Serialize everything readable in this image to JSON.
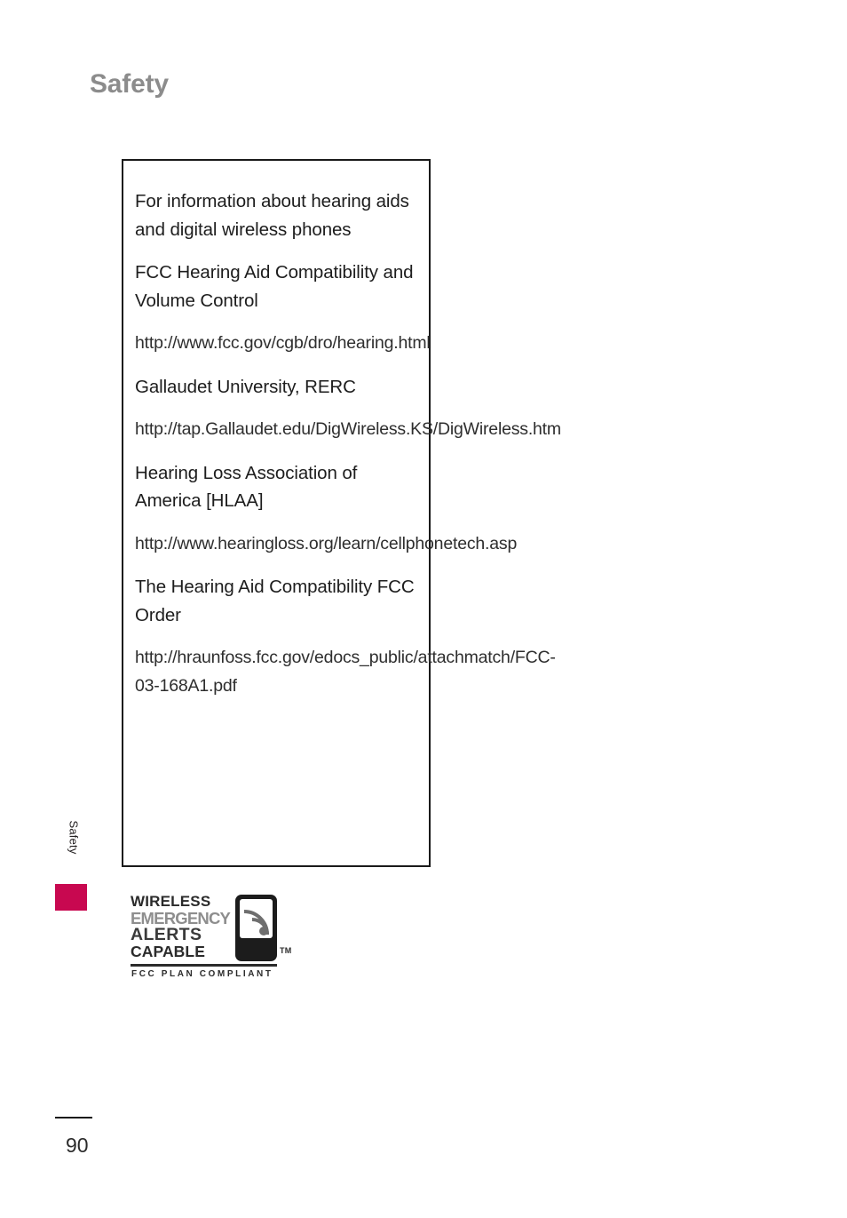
{
  "page": {
    "heading": "Safety",
    "number": "90",
    "side_tab_label": "Safety",
    "accent_color": "#c80850",
    "heading_color": "#8c8c8c",
    "text_color": "#1d1d1d"
  },
  "content_box": {
    "blocks": [
      {
        "kind": "title",
        "text": "For information about hearing aids and digital wireless phones"
      },
      {
        "kind": "title",
        "text": "FCC Hearing Aid Compatibility and Volume Control"
      },
      {
        "kind": "url",
        "text": "http://www.fcc.gov/cgb/dro/hearing.html"
      },
      {
        "kind": "title",
        "text": "Gallaudet University, RERC"
      },
      {
        "kind": "url",
        "text": "http://tap.Gallaudet.edu/DigWireless.KS/DigWireless.htm"
      },
      {
        "kind": "title",
        "text": "Hearing Loss Association of America [HLAA]"
      },
      {
        "kind": "url",
        "text": "http://www.hearingloss.org/learn/cellphonetech.asp"
      },
      {
        "kind": "title",
        "text": "The Hearing Aid Compatibility FCC Order"
      },
      {
        "kind": "url",
        "text": "http://hraunfoss.fcc.gov/edocs_public/attachmatch/FCC-03-168A1.pdf"
      }
    ]
  },
  "wea_logo": {
    "line1": "WIRELESS",
    "line2": "EMERGENCY",
    "line3": "ALERTS",
    "line4": "CAPABLE",
    "trademark": "TM",
    "subtitle": "FCC PLAN COMPLIANT",
    "icon": "phone-signal-icon"
  }
}
